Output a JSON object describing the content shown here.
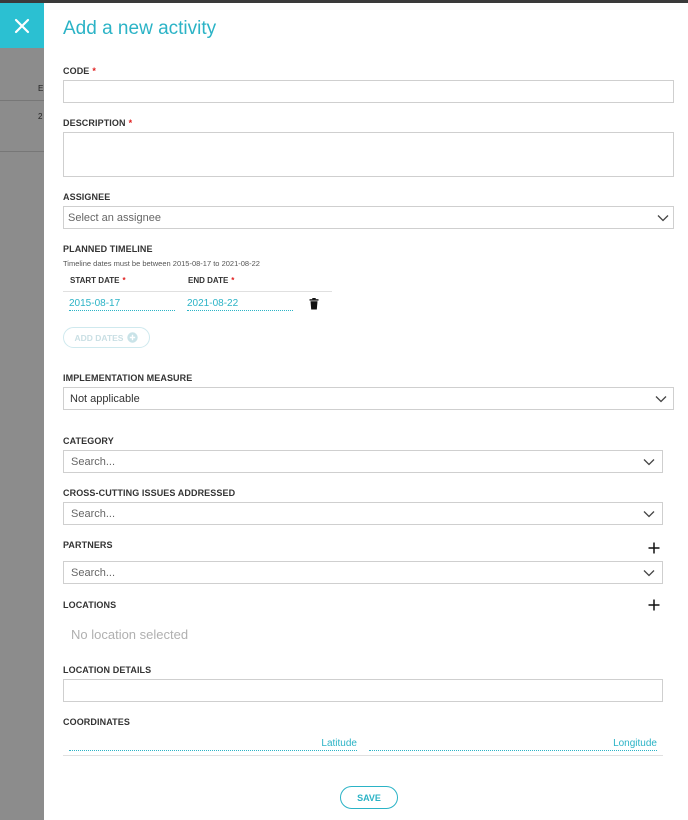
{
  "header": {
    "title": "Add a new activity"
  },
  "backdrop": {
    "fragment_top": "E",
    "fragment_row": "2"
  },
  "fields": {
    "code": {
      "label": "CODE",
      "required_mark": "*",
      "value": ""
    },
    "description": {
      "label": "DESCRIPTION",
      "required_mark": "*",
      "value": ""
    },
    "assignee": {
      "label": "ASSIGNEE",
      "placeholder": "Select an assignee"
    },
    "planned_timeline": {
      "label": "PLANNED TIMELINE",
      "hint": "Timeline dates must be between 2015-08-17 to 2021-08-22",
      "start_header": "START DATE",
      "end_header": "END DATE",
      "required_mark": "*",
      "rows": [
        {
          "start": "2015-08-17",
          "end": "2021-08-22"
        }
      ],
      "add_dates_label": "ADD DATES"
    },
    "implementation_measure": {
      "label": "IMPLEMENTATION MEASURE",
      "value": "Not applicable"
    },
    "category": {
      "label": "CATEGORY",
      "placeholder": "Search..."
    },
    "cross_cutting": {
      "label": "CROSS-CUTTING ISSUES ADDRESSED",
      "placeholder": "Search..."
    },
    "partners": {
      "label": "PARTNERS",
      "placeholder": "Search..."
    },
    "locations": {
      "label": "LOCATIONS",
      "empty_text": "No location selected"
    },
    "location_details": {
      "label": "LOCATION DETAILS",
      "value": ""
    },
    "coordinates": {
      "label": "COORDINATES",
      "latitude_placeholder": "Latitude",
      "longitude_placeholder": "Longitude"
    }
  },
  "actions": {
    "save_label": "SAVE"
  },
  "icons": {
    "close": "close-icon",
    "chevron": "chevron-down-icon",
    "trash": "trash-icon",
    "plus": "plus-icon",
    "add": "plus-circle-icon"
  },
  "colors": {
    "accent": "#2bb3c6",
    "close_bg": "#2bc0d2",
    "required": "#e02020"
  }
}
